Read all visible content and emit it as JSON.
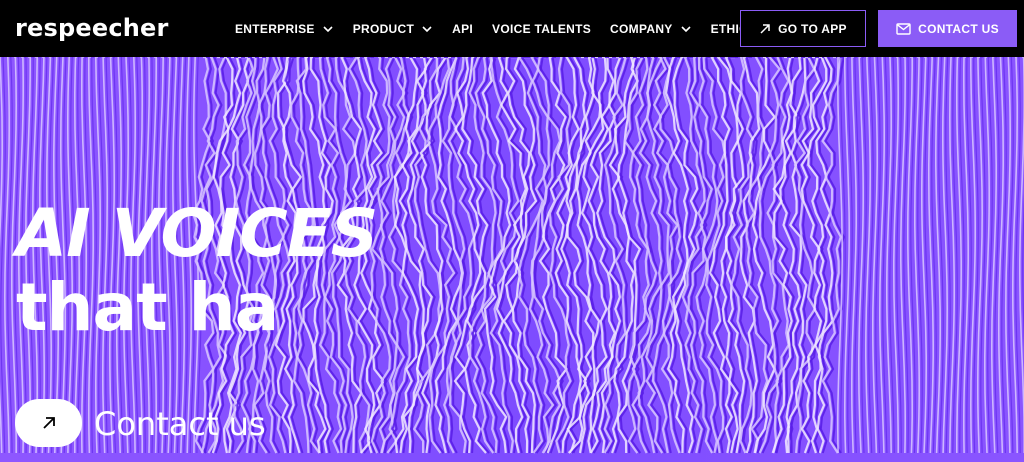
{
  "brand": {
    "logo_text": "respeecher"
  },
  "nav": {
    "items": [
      {
        "label": "ENTERPRISE",
        "has_dropdown": true
      },
      {
        "label": "PRODUCT",
        "has_dropdown": true
      },
      {
        "label": "API",
        "has_dropdown": false
      },
      {
        "label": "VOICE TALENTS",
        "has_dropdown": false
      },
      {
        "label": "COMPANY",
        "has_dropdown": true
      },
      {
        "label": "ETHICS",
        "has_dropdown": false
      }
    ]
  },
  "header_buttons": {
    "go_to_app": {
      "label": "GO TO APP",
      "icon": "arrow-up-right-icon"
    },
    "contact_us": {
      "label": "CONTACT US",
      "icon": "mail-icon"
    }
  },
  "hero": {
    "headline_line1": "AI VOICES",
    "headline_line2": "that ha",
    "cta_label": "Contact us",
    "cta_icon": "arrow-up-right-icon"
  },
  "colors": {
    "header_bg": "#000000",
    "accent": "#8b5cf6",
    "hero_bg": "#8452ff",
    "text": "#ffffff"
  }
}
